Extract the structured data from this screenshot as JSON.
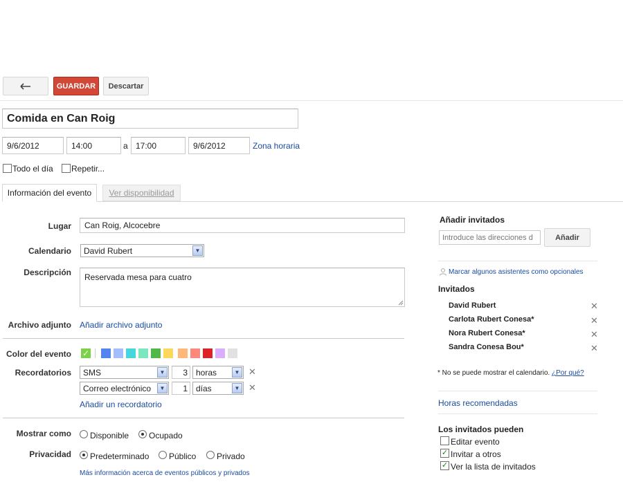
{
  "toolbar": {
    "back_icon": "back-arrow-icon",
    "save_label": "GUARDAR",
    "discard_label": "Descartar"
  },
  "event": {
    "title": "Comida en Can Roig",
    "start_date": "9/6/2012",
    "start_time": "14:00",
    "to_label": "a",
    "end_time": "17:00",
    "end_date": "9/6/2012",
    "timezone_link": "Zona horaria",
    "all_day_label": "Todo el día",
    "repeat_label": "Repetir..."
  },
  "tabs": {
    "info": "Información del evento",
    "availability": "Ver disponibilidad"
  },
  "details": {
    "where_label": "Lugar",
    "where_value": "Can Roig, Alcocebre",
    "calendar_label": "Calendario",
    "calendar_value": "David Rubert",
    "description_label": "Descripción",
    "description_value": "Reservada mesa para cuatro",
    "attachment_label": "Archivo adjunto",
    "attachment_link": "Añadir archivo adjunto",
    "color_label": "Color del evento",
    "colors": [
      "#7bd148",
      "#5484ed",
      "#a4bdfc",
      "#46d6db",
      "#7ae7bf",
      "#51b749",
      "#fbd75b",
      "#ffb878",
      "#ff887c",
      "#dc2127",
      "#dbadff",
      "#e1e1e1"
    ],
    "reminders_label": "Recordatorios",
    "reminders": [
      {
        "method": "SMS",
        "amount": "3",
        "unit": "horas"
      },
      {
        "method": "Correo electrónico",
        "amount": "1",
        "unit": "días"
      }
    ],
    "add_reminder_link": "Añadir un recordatorio",
    "show_as_label": "Mostrar como",
    "show_as_options": [
      "Disponible",
      "Ocupado"
    ],
    "show_as_selected": "Ocupado",
    "privacy_label": "Privacidad",
    "privacy_options": [
      "Predeterminado",
      "Público",
      "Privado"
    ],
    "privacy_selected": "Predeterminado",
    "privacy_info_link": "Más información acerca de eventos públicos y privados"
  },
  "guests": {
    "add_title": "Añadir invitados",
    "add_placeholder": "Introduce las direcciones d",
    "add_button": "Añadir",
    "optional_link": "Marcar algunos asistentes como opcionales",
    "guests_title": "Invitados",
    "list": [
      {
        "name": "David Rubert"
      },
      {
        "name": "Carlota Rubert Conesa*"
      },
      {
        "name": "Nora Rubert Conesa*"
      },
      {
        "name": "Sandra Conesa Bou*"
      }
    ],
    "calendar_note": "* No se puede mostrar el calendario.",
    "why_link": "¿Por qué?",
    "suggested_times": "Horas recomendadas",
    "can_title": "Los invitados pueden",
    "permissions": [
      {
        "label": "Editar evento",
        "checked": false
      },
      {
        "label": "Invitar a otros",
        "checked": true
      },
      {
        "label": "Ver la lista de invitados",
        "checked": true
      }
    ]
  }
}
